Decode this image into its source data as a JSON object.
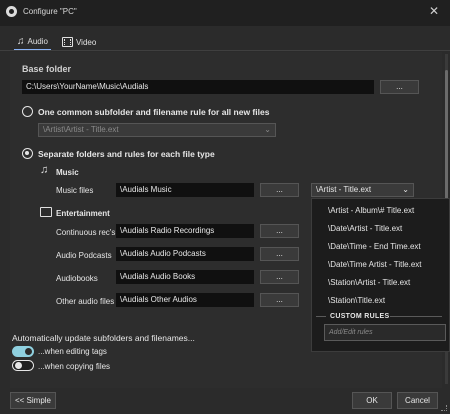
{
  "window": {
    "title": "Configure \"PC\"",
    "close": "✕"
  },
  "tabs": [
    {
      "label": "Audio"
    },
    {
      "label": "Video"
    }
  ],
  "base_folder": {
    "label": "Base folder",
    "value": "C:\\Users\\YourName\\Music\\Audials",
    "browse": "..."
  },
  "common_rule": {
    "label": "One common subfolder and filename rule for all new files",
    "value": "\\Artist\\Artist - Title.ext"
  },
  "separate": {
    "label": "Separate folders and rules for each file type"
  },
  "music": {
    "heading": "Music",
    "files_label": "Music files",
    "files_value": "\\Audials Music",
    "browse": "...",
    "rule_value": "\\Artist - Title.ext"
  },
  "entertainment": {
    "heading": "Entertainment",
    "rows": [
      {
        "label": "Continuous rec's",
        "value": "\\Audials Radio Recordings",
        "browse": "..."
      },
      {
        "label": "Audio Podcasts",
        "value": "\\Audials Audio Podcasts",
        "browse": "..."
      },
      {
        "label": "Audiobooks",
        "value": "\\Audials Audio Books",
        "browse": "..."
      },
      {
        "label": "Other audio files",
        "value": "\\Audials Other Audios",
        "browse": "..."
      }
    ]
  },
  "rule_dropdown": {
    "items": [
      "\\Artist - Album\\# Title.ext",
      "\\Date\\Artist - Title.ext",
      "\\Date\\Time - End Time.ext",
      "\\Date\\Time Artist - Title.ext",
      "\\Station\\Artist - Title.ext",
      "\\Station\\Title.ext"
    ],
    "custom_heading": "CUSTOM RULES",
    "custom_placeholder": "Add/Edit rules"
  },
  "auto_update": {
    "label": "Automatically update subfolders and filenames...",
    "editing_label": "...when editing tags",
    "editing_on": true,
    "copying_label": "...when copying files",
    "copying_on": false
  },
  "footer": {
    "simple": "<< Simple",
    "ok": "OK",
    "cancel": "Cancel"
  },
  "colors": {
    "accent": "#8ab4f8",
    "toggle_on": "#8fd0df",
    "background": "#2b2b2b"
  },
  "icons": [
    "app-logo-icon",
    "close-icon",
    "music-note-icon",
    "film-icon",
    "chevron-down-icon",
    "resize-grip-icon"
  ]
}
